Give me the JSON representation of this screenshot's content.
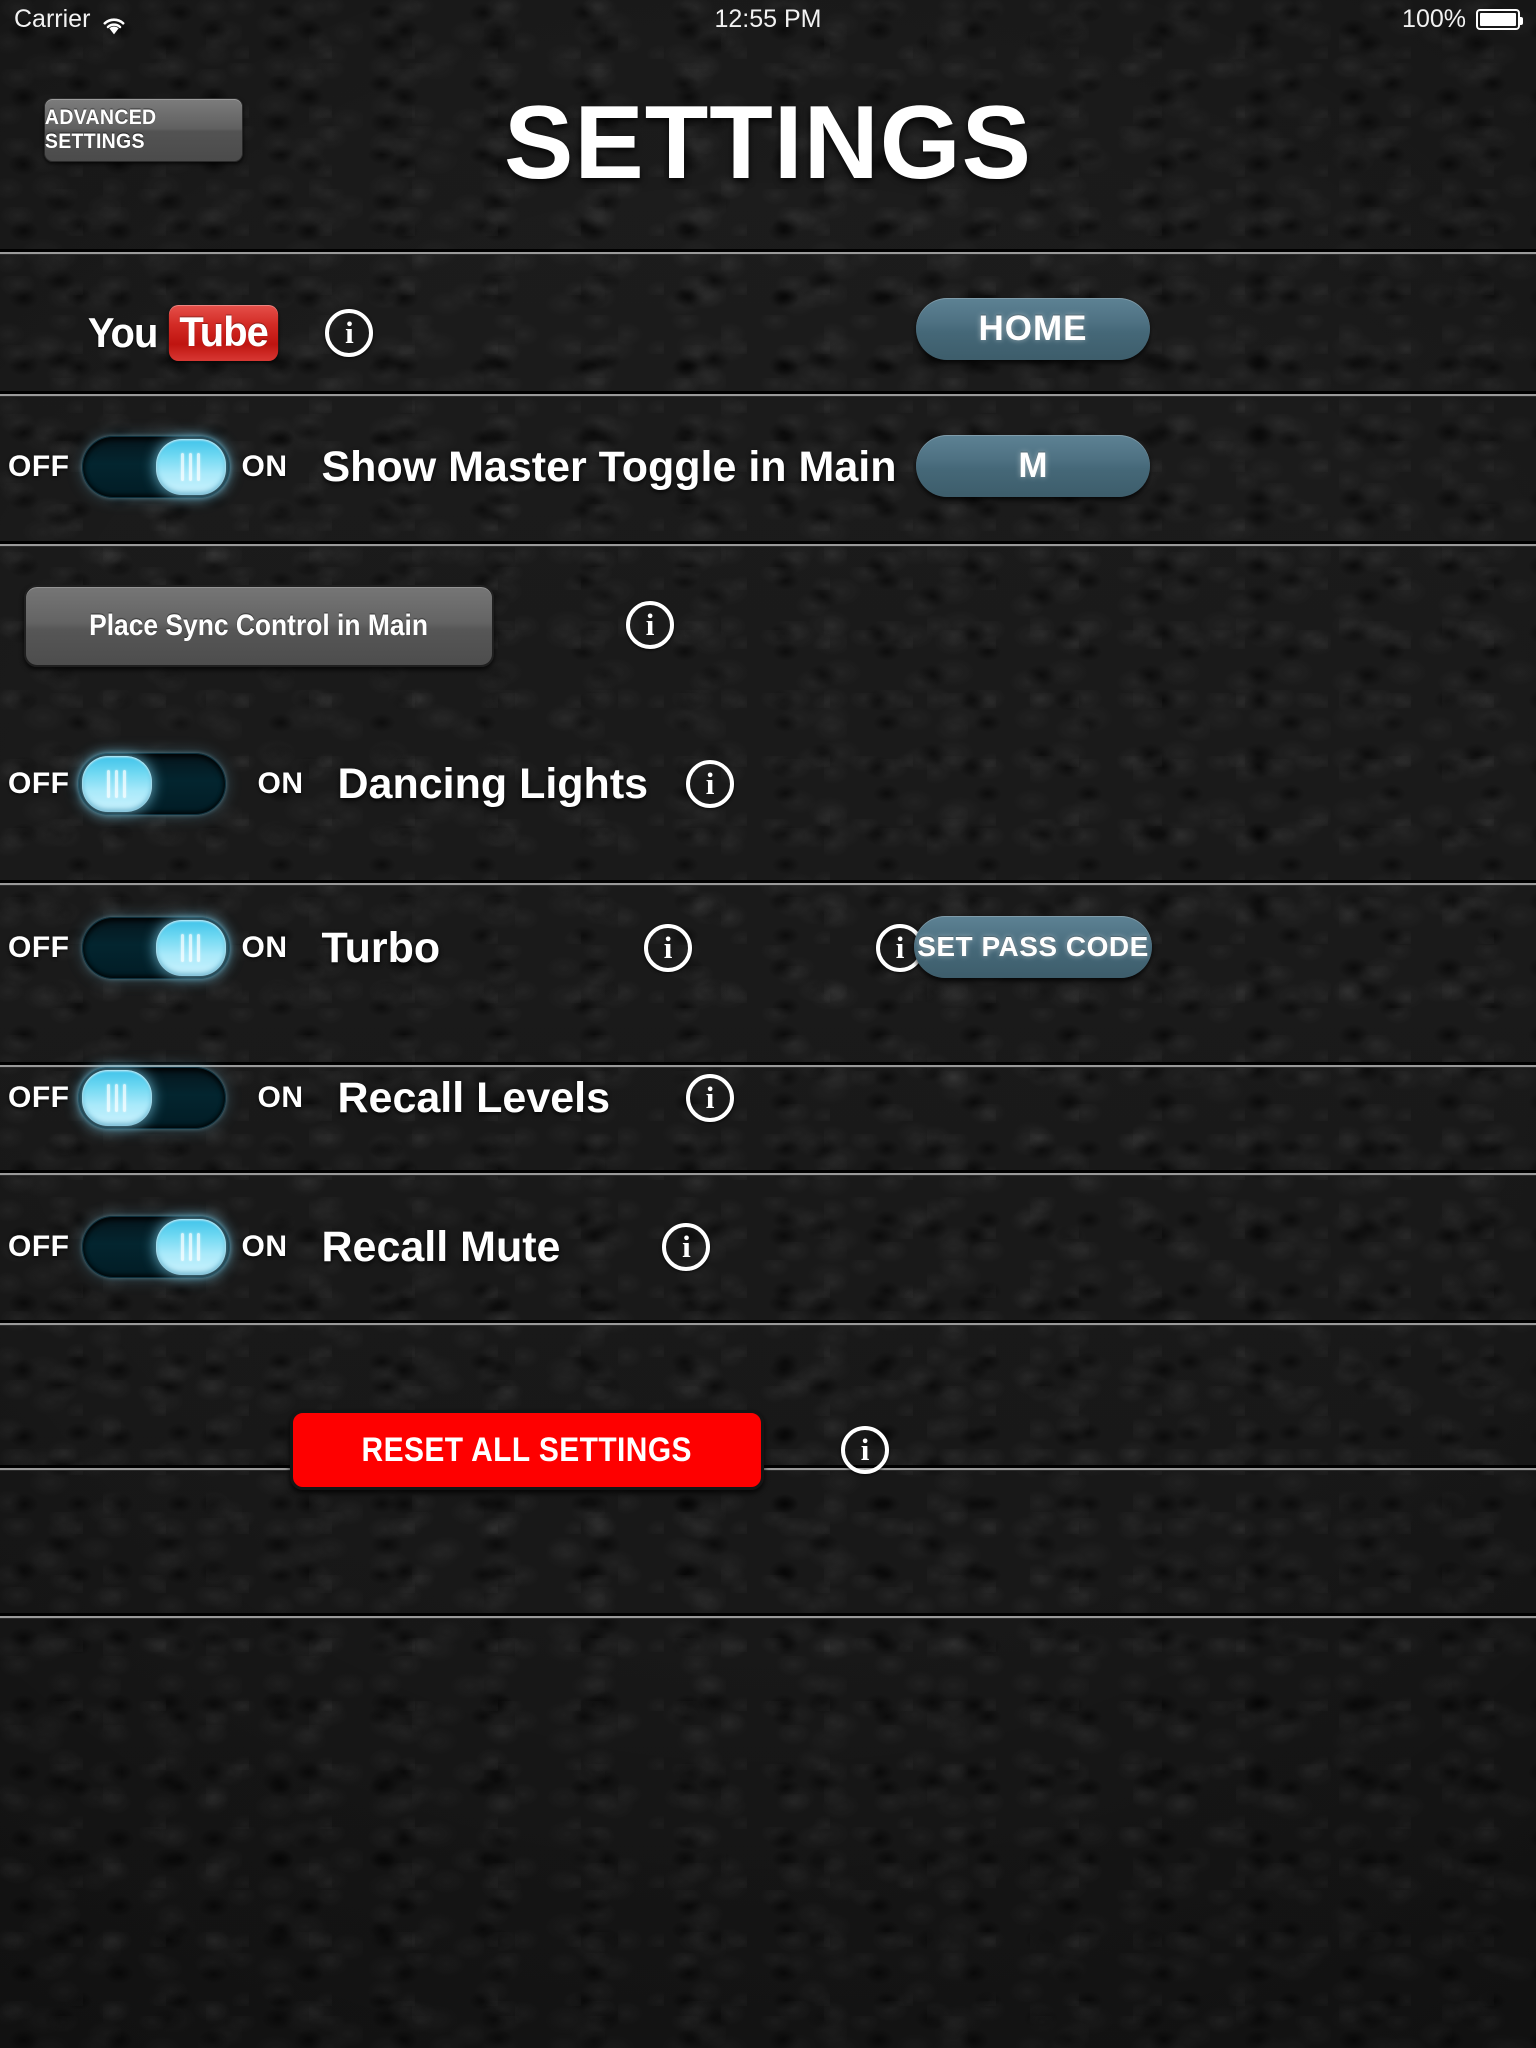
{
  "statusbar": {
    "carrier": "Carrier",
    "wifi_icon": "wifi-icon",
    "time": "12:55 PM",
    "battery_percent": "100%",
    "battery_icon": "battery-full-icon"
  },
  "header": {
    "advanced_settings_label": "ADVANCED SETTINGS",
    "title": "SETTINGS"
  },
  "colors": {
    "background": "#1b1b1b",
    "pill_button": "#4e7182",
    "gray_button": "#646464",
    "reset_red": "#fe0000",
    "toggle_knob": "#6fd8f2",
    "toggle_track": "#03252f",
    "youtube_red": "#d32b25",
    "separator": "#9a9a9a"
  },
  "labels": {
    "off": "OFF",
    "on": "ON",
    "info_glyph": "i"
  },
  "rows": [
    {
      "id": "youtube-row",
      "logo": "youtube-logo",
      "logo_text_part1": "You",
      "logo_text_part2": "Tube",
      "info_icon": "info-icon",
      "button": "HOME"
    },
    {
      "id": "master-toggle-row",
      "toggle_state": "on",
      "off_label": "OFF",
      "on_label": "ON",
      "label": "Show Master Toggle in Main",
      "info_icon": "info-icon",
      "button": "M"
    },
    {
      "id": "sync-control-row",
      "button": "Place Sync Control in Main",
      "info_icon": "info-icon"
    },
    {
      "id": "dancing-lights-row",
      "toggle_state": "off",
      "off_label": "OFF",
      "on_label": "ON",
      "label": "Dancing Lights",
      "info_icon": "info-icon"
    },
    {
      "id": "turbo-row",
      "toggle_state": "on",
      "off_label": "OFF",
      "on_label": "ON",
      "label": "Turbo",
      "info_icon": "info-icon",
      "info_icon2": "info-icon",
      "button": "SET PASS CODE"
    },
    {
      "id": "recall-levels-row",
      "toggle_state": "off",
      "off_label": "OFF",
      "on_label": "ON",
      "label": "Recall Levels",
      "info_icon": "info-icon"
    },
    {
      "id": "recall-mute-row",
      "toggle_state": "on",
      "off_label": "OFF",
      "on_label": "ON",
      "label": "Recall Mute",
      "info_icon": "info-icon"
    },
    {
      "id": "reset-row",
      "button": "RESET ALL SETTINGS",
      "info_icon": "info-icon"
    }
  ]
}
